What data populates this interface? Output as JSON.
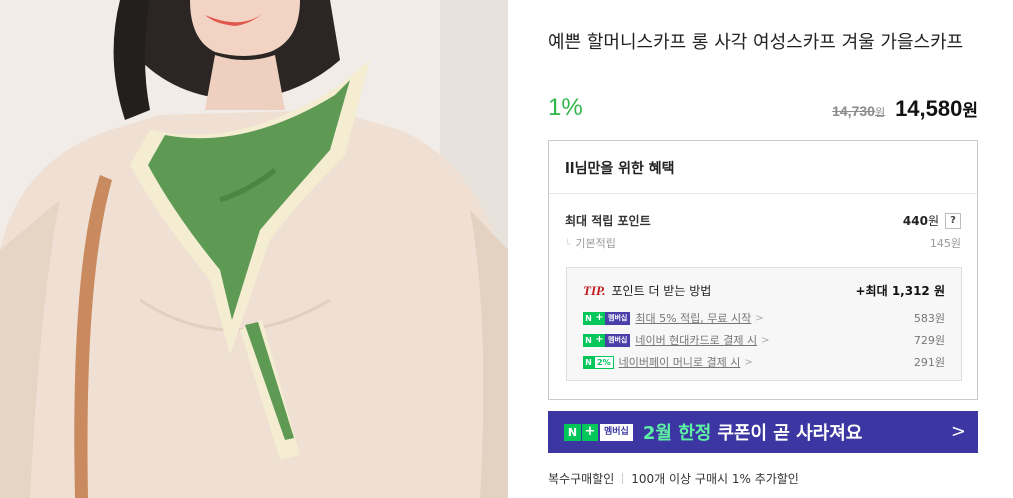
{
  "product": {
    "title": "예쁜 할머니스카프 롱 사각 여성스카프 겨울 가을스카프",
    "discount_rate": "1%",
    "original_price": "14,730",
    "original_unit": "원",
    "sale_price": "14,580",
    "sale_unit": "원"
  },
  "benefit": {
    "heading": "ll님만을 위한 혜택",
    "max_points_label": "최대 적립 포인트",
    "max_points_value": "440",
    "max_points_unit": "원",
    "help_symbol": "?",
    "base_label": "기본적립",
    "base_value": "145원",
    "tip": {
      "tip_word": "TIP.",
      "title": "포인트 더 받는 방법",
      "total": "+최대 1,312 원",
      "items": [
        {
          "badge_n": "N",
          "badge_plus": "+",
          "badge_text": "멤버십",
          "text": "최대 5% 적립, 무료 시작",
          "chevron": ">",
          "amount": "583원"
        },
        {
          "badge_n": "N",
          "badge_plus": "+",
          "badge_text": "멤버십",
          "text": "네이버 현대카드로 결제 시",
          "chevron": ">",
          "amount": "729원"
        },
        {
          "badge_n": "N",
          "badge_pct": "2%",
          "text": "네이버페이 머니로 결제 시",
          "chevron": ">",
          "amount": "291원"
        }
      ]
    }
  },
  "banner": {
    "badge_n": "N",
    "badge_plus": "+",
    "badge_text": "멤버십",
    "highlight": "2월 한정",
    "text": "쿠폰이 곧 사라져요",
    "arrow": ">"
  },
  "multi_buy": {
    "label": "복수구매할인",
    "text": "100개 이상 구매시 1% 추가할인"
  },
  "colors": {
    "discount_green": "#30b64a",
    "banner_purple": "#3b36a1",
    "naver_green": "#03c75a",
    "tip_red": "#c0191e"
  }
}
